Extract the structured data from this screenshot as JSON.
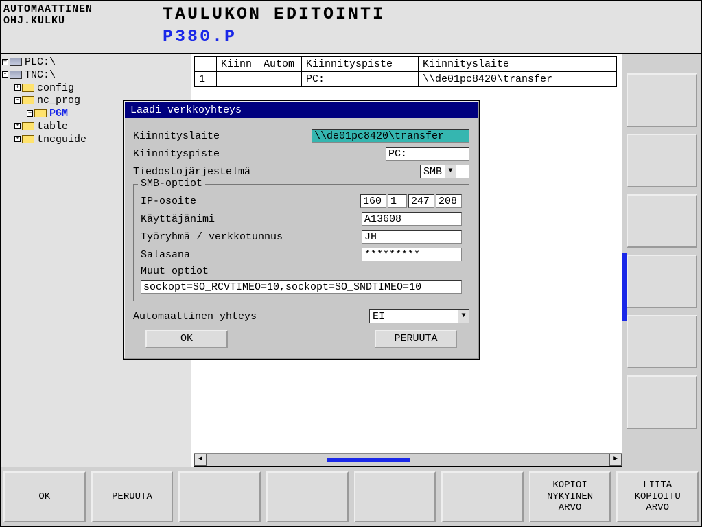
{
  "header": {
    "mode_line1": "AUTOMAATTINEN",
    "mode_line2": "OHJ.KULKU",
    "title": "TAULUKON EDITOINTI",
    "subtitle": "P380.P"
  },
  "tree": {
    "items": [
      {
        "label": "PLC:\\",
        "type": "disk",
        "depth": 0
      },
      {
        "label": "TNC:\\",
        "type": "disk",
        "depth": 0
      },
      {
        "label": "config",
        "type": "folder",
        "depth": 1
      },
      {
        "label": "nc_prog",
        "type": "folder-open",
        "depth": 1
      },
      {
        "label": "PGM",
        "type": "folder-open",
        "depth": 2,
        "selected": true
      },
      {
        "label": "table",
        "type": "folder",
        "depth": 1
      },
      {
        "label": "tncguide",
        "type": "folder",
        "depth": 1
      }
    ]
  },
  "table": {
    "cols": [
      "Kiinn",
      "Autom",
      "Kiinnityspiste",
      "Kiinnityslaite"
    ],
    "row": {
      "n": "1",
      "kiinn": "",
      "autom": "",
      "kp": "PC:",
      "kl": "\\\\de01pc8420\\transfer"
    }
  },
  "dialog": {
    "title": "Laadi verkkoyhteys",
    "labels": {
      "device": "Kiinnityslaite",
      "mount": "Kiinnityspiste",
      "fs": "Tiedostojärjestelmä",
      "smb_group": "SMB-optiot",
      "ip": "IP-osoite",
      "user": "Käyttäjänimi",
      "wg": "Työryhmä / verkkotunnus",
      "pw": "Salasana",
      "other": "Muut optiot",
      "auto": "Automaattinen yhteys"
    },
    "values": {
      "device": "\\\\de01pc8420\\transfer",
      "mount": "PC:",
      "fs": "SMB",
      "ip": [
        "160",
        "1",
        "247",
        "208"
      ],
      "user": "A13608",
      "wg": "JH",
      "pw": "*********",
      "other": "sockopt=SO_RCVTIMEO=10,sockopt=SO_SNDTIMEO=10",
      "auto": "EI"
    },
    "buttons": {
      "ok": "OK",
      "cancel": "PERUUTA"
    }
  },
  "softkeys": {
    "bottom": [
      "OK",
      "PERUUTA",
      "",
      "",
      "",
      "",
      "KOPIOI\nNYKYINEN\nARVO",
      "LIITÄ\nKOPIOITU\nARVO"
    ]
  }
}
